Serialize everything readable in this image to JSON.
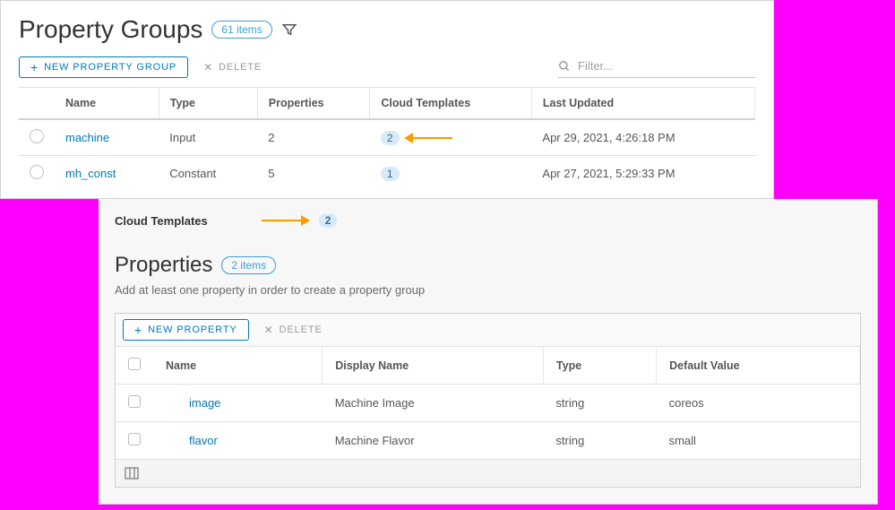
{
  "header": {
    "title": "Property Groups",
    "count_label": "61 items"
  },
  "toolbar_top": {
    "new_label": "NEW PROPERTY GROUP",
    "delete_label": "DELETE",
    "filter_placeholder": "Filter..."
  },
  "groups_table": {
    "columns": {
      "name": "Name",
      "type": "Type",
      "properties": "Properties",
      "cloud_templates": "Cloud Templates",
      "last_updated": "Last Updated"
    },
    "rows": [
      {
        "name": "machine",
        "type": "Input",
        "properties": "2",
        "cloud_templates": "2",
        "last_updated": "Apr 29, 2021, 4:26:18 PM"
      },
      {
        "name": "mh_const",
        "type": "Constant",
        "properties": "5",
        "cloud_templates": "1",
        "last_updated": "Apr 27, 2021, 5:29:33 PM"
      }
    ]
  },
  "detail": {
    "cloud_templates_label": "Cloud Templates",
    "cloud_templates_count": "2",
    "props_title": "Properties",
    "props_count_label": "2 items",
    "helper_text": "Add at least one property in order to create a property group",
    "toolbar": {
      "new_label": "NEW PROPERTY",
      "delete_label": "DELETE"
    },
    "columns": {
      "name": "Name",
      "display_name": "Display Name",
      "type": "Type",
      "default_value": "Default Value"
    },
    "rows": [
      {
        "name": "image",
        "display_name": "Machine Image",
        "type": "string",
        "default_value": "coreos"
      },
      {
        "name": "flavor",
        "display_name": "Machine Flavor",
        "type": "string",
        "default_value": "small"
      }
    ]
  }
}
